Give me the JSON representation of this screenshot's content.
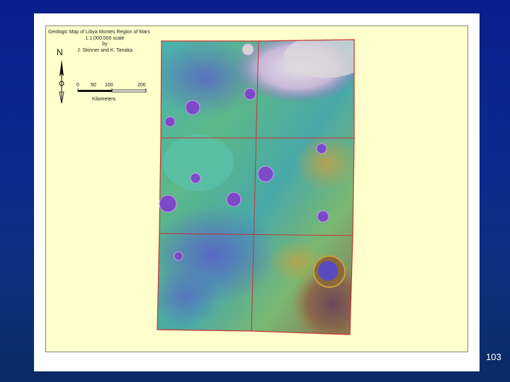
{
  "map": {
    "title_lines": [
      "Geologic Map of Libya Montes Region of Mars",
      "1:1,000,000 scale",
      "by",
      "J. Skinner and K. Tanaka"
    ],
    "north_label": "N",
    "scale_ticks": [
      "0",
      "50",
      "100",
      "200"
    ],
    "scale_unit": "Kilometers",
    "colors": {
      "sheet_background": "#ffffcc",
      "grid_lines": "#c83232",
      "lowland": "#7a5a7a",
      "highland": "#d8d0d8",
      "mid_elevation": "#46b4a0",
      "crater_fill": "#7a4ac8"
    }
  },
  "slide": {
    "page_number": "103"
  }
}
